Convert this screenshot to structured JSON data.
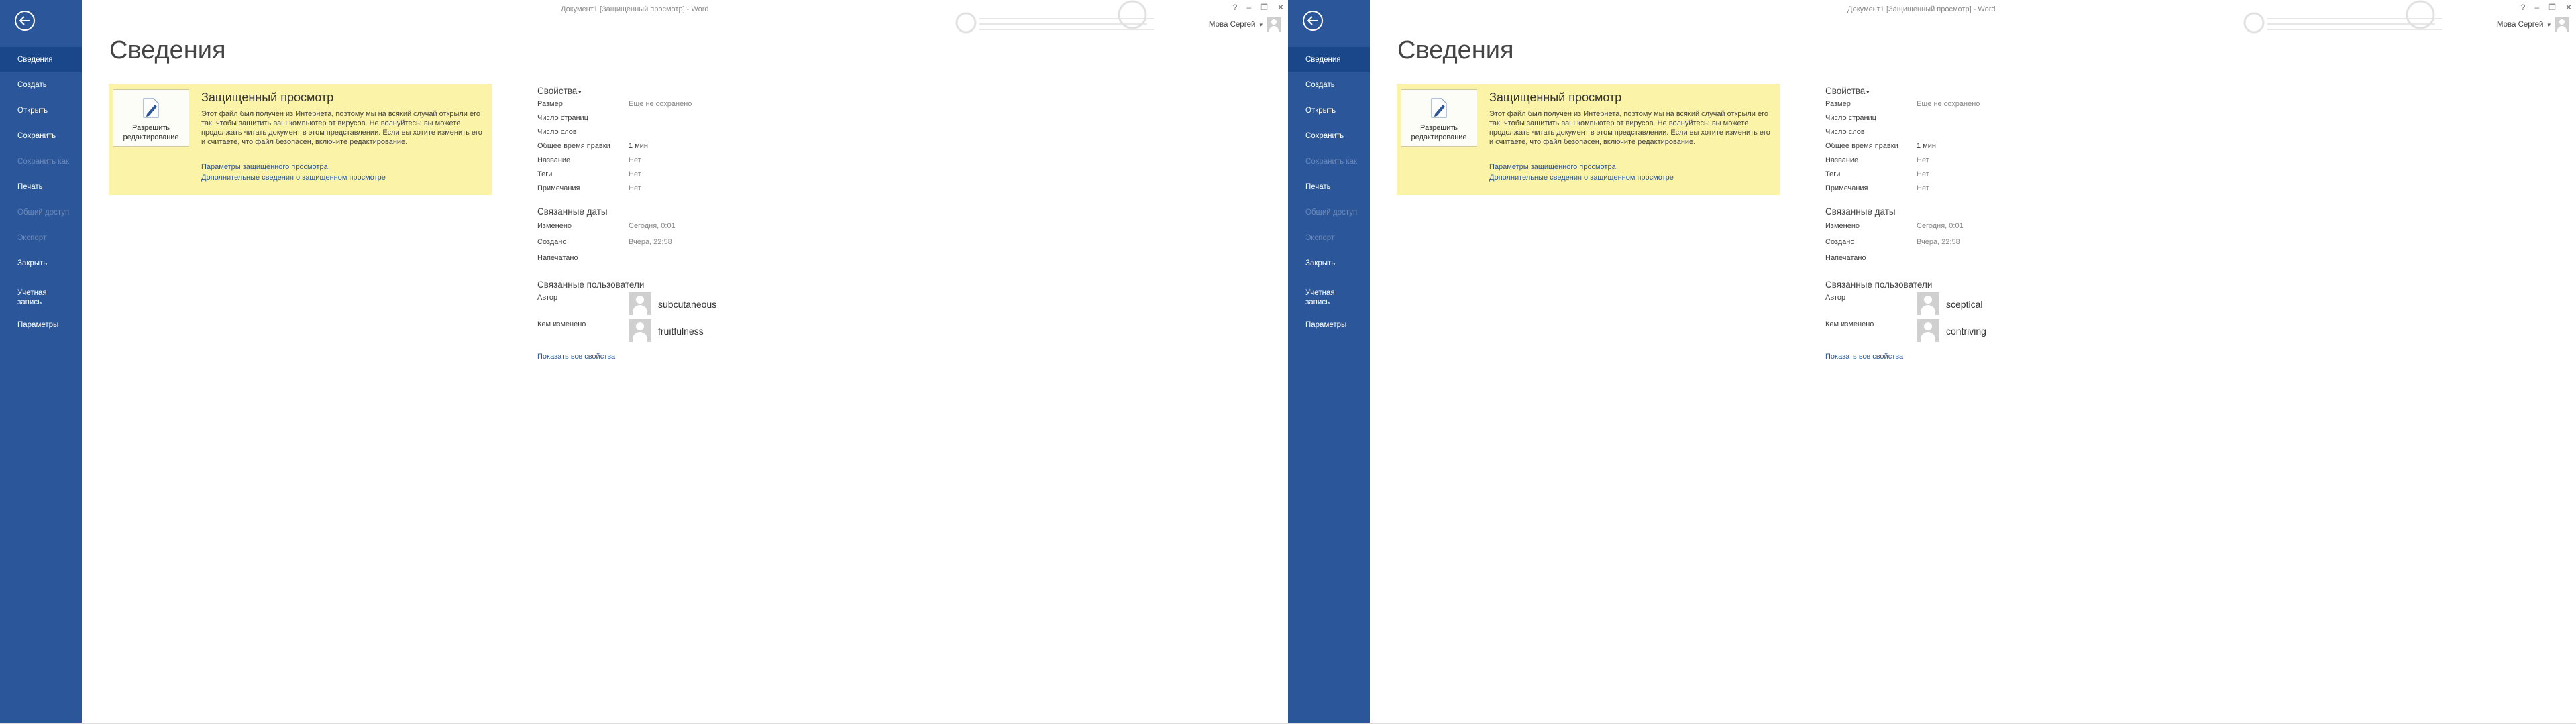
{
  "screens": [
    {
      "title_bar": {
        "doc_title": "Документ1 [Защищенный просмотр] - Word",
        "win_controls": [
          "?",
          "–",
          "❐",
          "✕"
        ]
      },
      "account": {
        "user_name": "Мова Сергей"
      },
      "sidebar": {
        "items": [
          {
            "label": "Сведения"
          },
          {
            "label": "Создать"
          },
          {
            "label": "Открыть"
          },
          {
            "label": "Сохранить"
          },
          {
            "label": "Сохранить как"
          },
          {
            "label": "Печать"
          },
          {
            "label": "Общий доступ"
          },
          {
            "label": "Экспорт"
          },
          {
            "label": "Закрыть"
          },
          {
            "label": "Учетная\nзапись"
          },
          {
            "label": "Параметры"
          }
        ]
      },
      "page_title": "Сведения",
      "protected_view": {
        "button_label": "Разрешить\nредактирование",
        "heading": "Защищенный просмотр",
        "text": "Этот файл был получен из Интернета, поэтому мы на всякий случай открыли его так, чтобы защитить ваш компьютер от вирусов. Не волнуйтесь: вы можете продолжать читать документ в этом представлении. Если вы хотите изменить его и считаете, что файл безопасен, включите редактирование.",
        "link1": "Параметры защищенного просмотра",
        "link2": "Дополнительные сведения о защищенном просмотре"
      },
      "properties": {
        "heading": "Свойства",
        "rows": [
          {
            "k": "Размер",
            "v": "Еще не сохранено"
          },
          {
            "k": "Число страниц",
            "v": ""
          },
          {
            "k": "Число слов",
            "v": ""
          },
          {
            "k": "Общее время правки",
            "v": "1 мин"
          },
          {
            "k": "Название",
            "v": "Нет"
          },
          {
            "k": "Теги",
            "v": "Нет"
          },
          {
            "k": "Примечания",
            "v": "Нет"
          }
        ]
      },
      "dates": {
        "heading": "Связанные даты",
        "rows": [
          {
            "k": "Изменено",
            "v": "Сегодня, 0:01"
          },
          {
            "k": "Создано",
            "v": "Вчера, 22:58"
          },
          {
            "k": "Напечатано",
            "v": ""
          }
        ]
      },
      "people": {
        "heading": "Связанные пользователи",
        "author_label": "Автор",
        "author": "subcutaneous",
        "modified_label": "Кем изменено",
        "modified_by": "fruitfulness"
      },
      "show_all": "Показать все свойства"
    },
    {
      "title_bar": {
        "doc_title": "Документ1 [Защищенный просмотр] - Word",
        "win_controls": [
          "?",
          "–",
          "❐",
          "✕"
        ]
      },
      "account": {
        "user_name": "Мова Сергей"
      },
      "sidebar": {
        "items": [
          {
            "label": "Сведения"
          },
          {
            "label": "Создать"
          },
          {
            "label": "Открыть"
          },
          {
            "label": "Сохранить"
          },
          {
            "label": "Сохранить как"
          },
          {
            "label": "Печать"
          },
          {
            "label": "Общий доступ"
          },
          {
            "label": "Экспорт"
          },
          {
            "label": "Закрыть"
          },
          {
            "label": "Учетная\nзапись"
          },
          {
            "label": "Параметры"
          }
        ]
      },
      "page_title": "Сведения",
      "protected_view": {
        "button_label": "Разрешить\nредактирование",
        "heading": "Защищенный просмотр",
        "text": "Этот файл был получен из Интернета, поэтому мы на всякий случай открыли его так, чтобы защитить ваш компьютер от вирусов. Не волнуйтесь: вы можете продолжать читать документ в этом представлении. Если вы хотите изменить его и считаете, что файл безопасен, включите редактирование.",
        "link1": "Параметры защищенного просмотра",
        "link2": "Дополнительные сведения о защищенном просмотре"
      },
      "properties": {
        "heading": "Свойства",
        "rows": [
          {
            "k": "Размер",
            "v": "Еще не сохранено"
          },
          {
            "k": "Число страниц",
            "v": ""
          },
          {
            "k": "Число слов",
            "v": ""
          },
          {
            "k": "Общее время правки",
            "v": "1 мин"
          },
          {
            "k": "Название",
            "v": "Нет"
          },
          {
            "k": "Теги",
            "v": "Нет"
          },
          {
            "k": "Примечания",
            "v": "Нет"
          }
        ]
      },
      "dates": {
        "heading": "Связанные даты",
        "rows": [
          {
            "k": "Изменено",
            "v": "Сегодня, 0:01"
          },
          {
            "k": "Создано",
            "v": "Вчера, 22:58"
          },
          {
            "k": "Напечатано",
            "v": ""
          }
        ]
      },
      "people": {
        "heading": "Связанные пользователи",
        "author_label": "Автор",
        "author": "sceptical",
        "modified_label": "Кем изменено",
        "modified_by": "contriving"
      },
      "show_all": "Показать все свойства"
    }
  ],
  "colors": {
    "sidebar": "#2b579a",
    "sidebar_active": "#19478a",
    "protected_bg": "#fbf3a8",
    "link": "#2b579a"
  }
}
